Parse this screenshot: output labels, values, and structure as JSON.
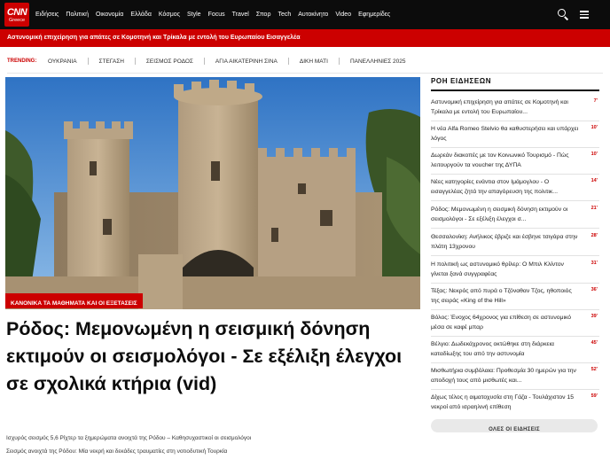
{
  "brand": {
    "logo_text": "CNN",
    "edition": "Greece",
    "accent": "#cc0000",
    "nav_bg": "#0c0c0c"
  },
  "nav": {
    "items": [
      "Ειδήσεις",
      "Πολιτική",
      "Οικονομία",
      "Ελλάδα",
      "Κόσμος",
      "Style",
      "Focus",
      "Travel",
      "Σπορ",
      "Tech",
      "Αυτοκίνητο",
      "Video",
      "Εφημερίδες"
    ],
    "icons": [
      "search-icon",
      "menu-icon"
    ]
  },
  "breaking": {
    "text": "Αστυνομική επιχείρηση για απάτες σε Κομοτηνή και Τρίκαλα με εντολή του Ευρωπαίου Εισαγγελέα"
  },
  "trending": {
    "label": "TRENDING:",
    "items": [
      "ΟΥΚΡΑΝΙΑ",
      "ΣΤΕΓΑΣΗ",
      "ΣΕΙΣΜΟΣ ΡΟΔΟΣ",
      "ΑΓΙΑ ΑΙΚΑΤΕΡΙΝΗ ΣΙΝΑ",
      "ΔΙΚΗ ΜΑΤΙ",
      "ΠΑΝΕΛΛΗΝΙΕΣ 2025"
    ]
  },
  "main": {
    "tag": "ΚΑΝΟΝΙΚΑ ΤΑ ΜΑΘΗΜΑΤΑ ΚΑΙ ΟΙ ΕΞΕΤΑΣΕΙΣ",
    "headline": "Ρόδος: Μεμονωμένη η σεισμική δόνηση εκτιμούν οι σεισμολόγοι - Σε εξέλιξη έλεγχοι σε σχολικά κτήρια (vid)",
    "related": [
      "Ισχυρός σεισμός 5,6 Ρίχτερ τα ξημερώματα ανοιχτά της Ρόδου – Καθησυχαστικοί οι σεισμολόγοι",
      "Σεισμός ανοιχτά της Ρόδου: Μία νεκρή και δεκάδες τραυματίες στη νοτιοδυτική Τουρκία"
    ]
  },
  "sidebar": {
    "title": "ΡΟΗ ΕΙΔΗΣΕΩΝ",
    "items": [
      {
        "text": "Αστυνομική επιχείρηση για απάτες σε Κομοτηνή και Τρίκαλα με εντολή του Ευρωπαίου...",
        "time": "7'"
      },
      {
        "text": "Η νέα Alfa Romeo Stelvio θα καθυστερήσει και υπάρχει λόγος",
        "time": "10'"
      },
      {
        "text": "Δωρεάν διακοπές με τον Κοινωνικό Τουρισμό - Πώς λειτουργούν τα voucher της ΔΥΠΑ",
        "time": "10'"
      },
      {
        "text": "Νέες κατηγορίες ενάντια στον Ιμάμογλου - Ο εισαγγελέας ζητά την απαγόρευση της πολιτικ...",
        "time": "14'"
      },
      {
        "text": "Ρόδος: Μεμονωμένη η σεισμική δόνηση εκτιμούν οι σεισμολόγοι - Σε εξέλιξη έλεγχοι σ...",
        "time": "21'"
      },
      {
        "text": "Θεσσαλονίκη: Ανήλικος έβριζε και έσβηνε τσιγάρα στην πλάτη 13χρονου",
        "time": "28'"
      },
      {
        "text": "Η πολιτική ως αστυνομικό θρίλερ: Ο Μπιλ Κλίντον γίνεται ξανά συγγραφέας",
        "time": "31'"
      },
      {
        "text": "Τέξας: Νεκρός από πυρά ο Τζόναθαν Τζος, ηθοποιός της σειράς «King of the Hill»",
        "time": "36'"
      },
      {
        "text": "Βόλος: Ένοχος 64χρονος για επίθεση σε αστυνομικό μέσα σε καφέ μπαρ",
        "time": "39'"
      },
      {
        "text": "Βέλγιο: Δωδεκάχρονος οκτώθηκε στη διάρκεια καταδίωξης του από την αστυνομία",
        "time": "45'"
      },
      {
        "text": "Μισθωτήρια συμβόλαια: Προθεσμία 30 ημερών για την αποδοχή τους από μισθωτές και...",
        "time": "52'"
      },
      {
        "text": "Δίχως τέλος η αιματοχυσία στη Γάζα - Τουλάχιστον 15 νεκροί από ισραηλινή επίθεση",
        "time": "59'"
      }
    ],
    "all_news_label": "ΟΛΕΣ ΟΙ ΕΙΔΗΣΕΙΣ"
  }
}
